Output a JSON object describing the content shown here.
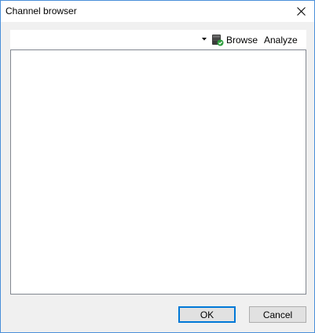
{
  "window": {
    "title": "Channel browser"
  },
  "toolbar": {
    "browse_label": "Browse",
    "analyze_label": "Analyze"
  },
  "dialog": {
    "ok_label": "OK",
    "cancel_label": "Cancel"
  },
  "icons": {
    "close": "close-icon",
    "dropdown": "dropdown-arrow-icon",
    "browse": "browse-icon"
  },
  "colors": {
    "window_border": "#4a8fd9",
    "accent": "#0078d7"
  }
}
